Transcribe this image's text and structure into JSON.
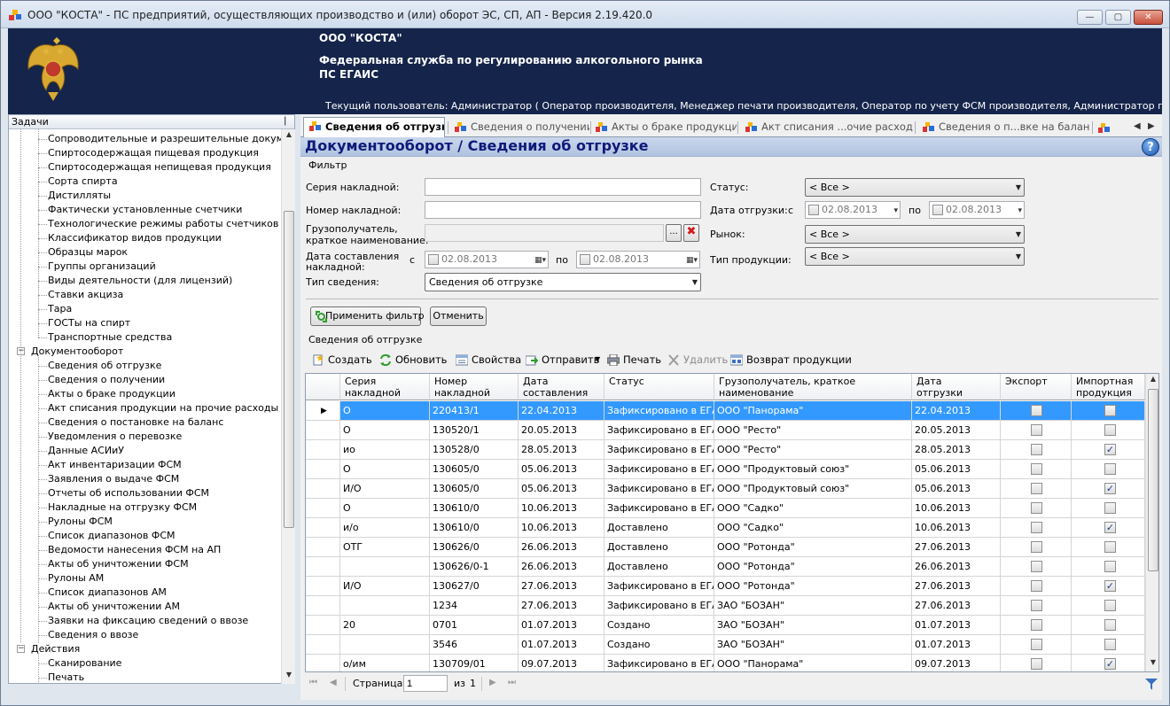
{
  "window": {
    "title": "ООО \"КОСТА\" - ПС предприятий, осуществляющих производство и (или) оборот ЭС, СП, АП - Версия 2.19.420.0",
    "minimize": "—",
    "maximize": "▢",
    "close": "✕"
  },
  "banner": {
    "org": "ООО \"КОСТА\"",
    "agency": "Федеральная служба по регулированию алкогольного рынка",
    "system": "ПС ЕГАИС",
    "user": "Текущий пользователь: Администратор ( Оператор производителя, Менеджер печати производителя, Оператор по учету ФСМ производителя, Администратор производителя, Опера..."
  },
  "sidebar": {
    "title": "Задачи",
    "pin": "ᵖ",
    "items": [
      {
        "label": "Сопроводительные и разрешительные документы",
        "level": 2
      },
      {
        "label": "Спиртосодержащая пищевая продукция",
        "level": 2
      },
      {
        "label": "Спиртосодержащая непищевая продукция",
        "level": 2
      },
      {
        "label": "Сорта спирта",
        "level": 2
      },
      {
        "label": "Дистилляты",
        "level": 2
      },
      {
        "label": "Фактически установленные счетчики",
        "level": 2
      },
      {
        "label": "Технологические режимы работы счетчиков",
        "level": 2
      },
      {
        "label": "Классификатор видов продукции",
        "level": 2
      },
      {
        "label": "Образцы марок",
        "level": 2
      },
      {
        "label": "Группы организаций",
        "level": 2
      },
      {
        "label": "Виды деятельности (для лицензий)",
        "level": 2
      },
      {
        "label": "Ставки акциза",
        "level": 2
      },
      {
        "label": "Тара",
        "level": 2
      },
      {
        "label": "ГОСТы на спирт",
        "level": 2
      },
      {
        "label": "Транспортные средства",
        "level": 2
      },
      {
        "label": "Документооборот",
        "level": 1,
        "expander": "−"
      },
      {
        "label": "Сведения об отгрузке",
        "level": 2
      },
      {
        "label": "Сведения о получении",
        "level": 2
      },
      {
        "label": "Акты о браке продукции",
        "level": 2
      },
      {
        "label": "Акт списания продукции на прочие расходы",
        "level": 2
      },
      {
        "label": "Сведения о постановке на баланс",
        "level": 2
      },
      {
        "label": "Уведомления о перевозке",
        "level": 2
      },
      {
        "label": "Данные АСИиУ",
        "level": 2
      },
      {
        "label": "Акт инвентаризации ФСМ",
        "level": 2
      },
      {
        "label": "Заявления о выдаче ФСМ",
        "level": 2
      },
      {
        "label": "Отчеты об использовании ФСМ",
        "level": 2
      },
      {
        "label": "Накладные на отгрузку ФСМ",
        "level": 2
      },
      {
        "label": "Рулоны ФСМ",
        "level": 2
      },
      {
        "label": "Список диапазонов ФСМ",
        "level": 2
      },
      {
        "label": "Ведомости нанесения ФСМ на АП",
        "level": 2
      },
      {
        "label": "Акты об уничтожении ФСМ",
        "level": 2
      },
      {
        "label": "Рулоны АМ",
        "level": 2
      },
      {
        "label": "Список диапазонов АМ",
        "level": 2
      },
      {
        "label": "Акты об уничтожении АМ",
        "level": 2
      },
      {
        "label": "Заявки на фиксацию сведений о ввозе",
        "level": 2
      },
      {
        "label": "Сведения о ввозе",
        "level": 2
      },
      {
        "label": "Действия",
        "level": 1,
        "expander": "−"
      },
      {
        "label": "Сканирование",
        "level": 2
      },
      {
        "label": "Печать",
        "level": 2
      }
    ]
  },
  "tabs": [
    {
      "label": "Сведения об отгрузке",
      "active": true
    },
    {
      "label": "Сведения о получении",
      "active": false
    },
    {
      "label": "Акты о браке продукции",
      "active": false
    },
    {
      "label": "Акт списания ...очие расходы",
      "active": false
    },
    {
      "label": "Сведения о п...вке на баланс",
      "active": false
    }
  ],
  "heading": {
    "title": "Документооборот  / Сведения об отгрузке",
    "help": "?"
  },
  "filter": {
    "group_label": "Фильтр",
    "series_label": "Серия накладной:",
    "series_value": "",
    "number_label": "Номер накладной:",
    "number_value": "",
    "consignee_label_1": "Грузополучатель,",
    "consignee_label_2": "краткое наименование:",
    "consignee_value": "",
    "browse_button": "...",
    "date_label_1": "Дата составления",
    "date_label_2": "накладной:",
    "from": "с",
    "to": "по",
    "date_from": "02.08.2013",
    "date_to": "02.08.2013",
    "type_label": "Тип сведения:",
    "type_value": "Сведения об отгрузке",
    "status_label": "Статус:",
    "status_value": "< Все >",
    "ship_date_label": "Дата отгрузки:",
    "ship_from": "с",
    "ship_to": "по",
    "ship_date_from": "02.08.2013",
    "ship_date_to": "02.08.2013",
    "market_label": "Рынок:",
    "market_value": "< Все >",
    "product_type_label": "Тип продукции:",
    "product_type_value": "< Все >",
    "apply_button": "Применить фильтр",
    "cancel_button": "Отменить"
  },
  "list": {
    "group_label": "Сведения об отгрузке",
    "toolbar": {
      "create": "Создать",
      "refresh": "Обновить",
      "properties": "Свойства",
      "send": "Отправить",
      "print": "Печать",
      "delete": "Удалить",
      "return": "Возврат продукции"
    },
    "columns": [
      [
        "Серия",
        "накладной"
      ],
      [
        "Номер",
        "накладной"
      ],
      [
        "Дата",
        "составления"
      ],
      [
        "Статус",
        ""
      ],
      [
        "Грузополучатель, краткое",
        "наименование"
      ],
      [
        "Дата",
        "отгрузки"
      ],
      [
        "Экспорт",
        ""
      ],
      [
        "Импортная",
        "продукция"
      ]
    ],
    "rows": [
      {
        "series": "О",
        "number": "220413/1",
        "date": "22.04.2013",
        "status": "Зафиксировано в ЕГАИС",
        "consignee": "ООО \"Панорама\"",
        "ship_date": "22.04.2013",
        "export": false,
        "import": false,
        "selected": true
      },
      {
        "series": "О",
        "number": "130520/1",
        "date": "20.05.2013",
        "status": "Зафиксировано в ЕГАИС",
        "consignee": "ООО \"Ресто\"",
        "ship_date": "20.05.2013",
        "export": false,
        "import": false
      },
      {
        "series": "ио",
        "number": "130528/0",
        "date": "28.05.2013",
        "status": "Зафиксировано в ЕГАИС",
        "consignee": "ООО \"Ресто\"",
        "ship_date": "28.05.2013",
        "export": false,
        "import": true
      },
      {
        "series": "О",
        "number": "130605/0",
        "date": "05.06.2013",
        "status": "Зафиксировано в ЕГАИС",
        "consignee": "ООО \"Продуктовый союз\"",
        "ship_date": "05.06.2013",
        "export": false,
        "import": false
      },
      {
        "series": "И/О",
        "number": "130605/0",
        "date": "05.06.2013",
        "status": "Зафиксировано в ЕГАИС",
        "consignee": "ООО \"Продуктовый союз\"",
        "ship_date": "05.06.2013",
        "export": false,
        "import": true
      },
      {
        "series": "О",
        "number": "130610/0",
        "date": "10.06.2013",
        "status": "Зафиксировано в ЕГАИС",
        "consignee": "ООО \"Садко\"",
        "ship_date": "10.06.2013",
        "export": false,
        "import": false
      },
      {
        "series": "и/о",
        "number": "130610/0",
        "date": "10.06.2013",
        "status": "Доставлено",
        "consignee": "ООО \"Садко\"",
        "ship_date": "10.06.2013",
        "export": false,
        "import": true
      },
      {
        "series": "ОТГ",
        "number": "130626/0",
        "date": "26.06.2013",
        "status": "Доставлено",
        "consignee": "ООО \"Ротонда\"",
        "ship_date": "27.06.2013",
        "export": false,
        "import": false
      },
      {
        "series": "",
        "number": "130626/0-1",
        "date": "26.06.2013",
        "status": "Доставлено",
        "consignee": "ООО \"Ротонда\"",
        "ship_date": "26.06.2013",
        "export": false,
        "import": false
      },
      {
        "series": "И/О",
        "number": "130627/0",
        "date": "27.06.2013",
        "status": "Зафиксировано в ЕГАИС",
        "consignee": "ООО \"Ротонда\"",
        "ship_date": "27.06.2013",
        "export": false,
        "import": true
      },
      {
        "series": "",
        "number": "1234",
        "date": "27.06.2013",
        "status": "Зафиксировано в ЕГАИС",
        "consignee": "ЗАО \"БОЗАН\"",
        "ship_date": "27.06.2013",
        "export": false,
        "import": false
      },
      {
        "series": "20",
        "number": "0701",
        "date": "01.07.2013",
        "status": "Создано",
        "consignee": "ЗАО \"БОЗАН\"",
        "ship_date": "01.07.2013",
        "export": false,
        "import": false
      },
      {
        "series": "",
        "number": "3546",
        "date": "01.07.2013",
        "status": "Создано",
        "consignee": "ЗАО \"БОЗАН\"",
        "ship_date": "01.07.2013",
        "export": false,
        "import": false
      },
      {
        "series": "о/им",
        "number": "130709/01",
        "date": "09.07.2013",
        "status": "Зафиксировано в ЕГАИС",
        "consignee": "ООО \"Панорама\"",
        "ship_date": "09.07.2013",
        "export": false,
        "import": true
      }
    ],
    "pager": {
      "page_label": "Страница",
      "page": "1",
      "of_label": "из",
      "total": "1"
    }
  }
}
